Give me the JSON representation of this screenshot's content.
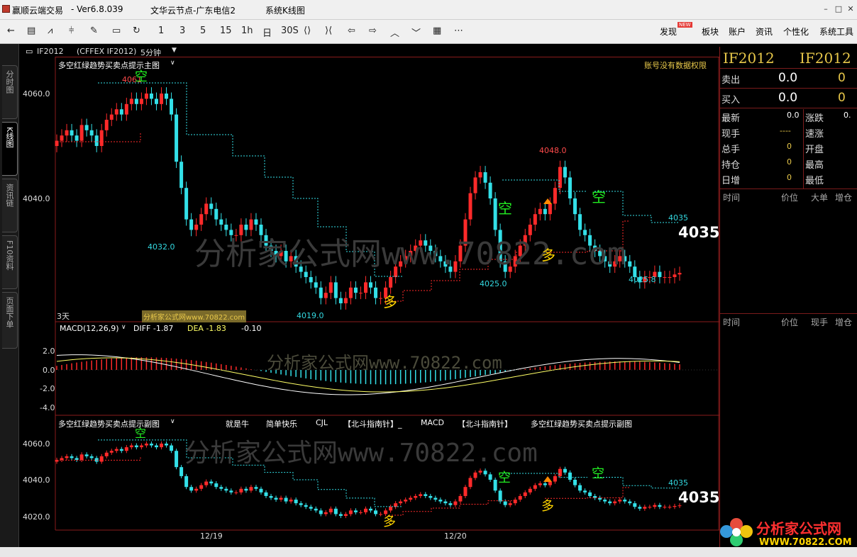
{
  "titlebar": {
    "app_name": "赢顺云端交易",
    "version": "- Ver6.8.039",
    "server": "文华云节点-广东电信2",
    "view": "系统K线图"
  },
  "toolbar": {
    "periods": [
      "1",
      "3",
      "5",
      "15",
      "1h",
      "日",
      "30S"
    ],
    "menus": [
      "发现",
      "板块",
      "账户",
      "资讯",
      "个性化",
      "系统工具"
    ],
    "new_badge": "NEW"
  },
  "left_tabs": [
    "分时图",
    "K线图",
    "资讯链",
    "F10资料",
    "页面下单"
  ],
  "chart_header": {
    "symbol": "IF2012",
    "exchange": "(CFFEX IF2012)",
    "period": "5分钟"
  },
  "main_chart": {
    "indicator_title": "多空红绿趋势买卖点提示主图",
    "notice": "账号没有数据权限",
    "y_ticks": [
      "4060.0",
      "4040.0"
    ],
    "days_label": "3天",
    "watermark_small": "分析家公式网www.70822.com",
    "watermark_big": "分析家公式网www.70822.com",
    "annotations": {
      "high1": "4061",
      "high2": "4048.0",
      "low1": "4032.0",
      "low2": "4019.0",
      "low3": "4025.0",
      "low4": "4025.8",
      "level": "4035",
      "last": "4035",
      "short_marker": "空",
      "long_marker": "多"
    }
  },
  "macd": {
    "title": "MACD(12,26,9)",
    "diff": "DIFF -1.87",
    "dea": "DEA -1.83",
    "macd_val": "-0.10",
    "y_ticks": [
      "2.0",
      "0.0",
      "-2.0",
      "-4.0"
    ],
    "watermark": "分析家公式网www.70822.com"
  },
  "sub_chart": {
    "title": "多空红绿趋势买卖点提示副图",
    "tabs": [
      "就是牛",
      "简单快乐",
      "CJL",
      "【北斗指南针】_",
      "MACD",
      "【北斗指南针】",
      "多空红绿趋势买卖点提示副图"
    ],
    "y_ticks": [
      "4060.0",
      "4040.0",
      "4020.0"
    ],
    "level": "4035",
    "last": "4035",
    "watermark": "分析家公式网www.70822.com"
  },
  "x_axis": [
    "12/19",
    "12/20"
  ],
  "right_panel": {
    "symbol_left": "IF2012",
    "symbol_right": "IF2012",
    "sell_label": "卖出",
    "sell_price": "0.0",
    "sell_vol": "0",
    "buy_label": "买入",
    "buy_price": "0.0",
    "buy_vol": "0",
    "stats": [
      {
        "label": "最新",
        "value": "0.0",
        "label2": "涨跌",
        "value2": "0."
      },
      {
        "label": "现手",
        "value": "----",
        "label2": "速涨",
        "value2": ""
      },
      {
        "label": "总手",
        "value": "0",
        "label2": "开盘",
        "value2": ""
      },
      {
        "label": "持仓",
        "value": "0",
        "label2": "最高",
        "value2": ""
      },
      {
        "label": "日增",
        "value": "0",
        "label2": "最低",
        "value2": ""
      }
    ],
    "table1_headers": [
      "时间",
      "价位",
      "大单",
      "增仓"
    ],
    "table2_headers": [
      "时间",
      "价位",
      "现手",
      "增仓"
    ]
  },
  "brand": {
    "name": "分析家公式网",
    "url": "WWW.70822.COM"
  },
  "colors": {
    "up": "#ff2a2a",
    "down": "#33e0e8",
    "axis": "#8a1c1c",
    "annotation_up": "#ff4b4b",
    "annotation_down": "#33d8e0",
    "short": "#22ee22",
    "long": "#ffd400",
    "macd_diff": "#ffffff",
    "macd_dea": "#ffff66"
  }
}
